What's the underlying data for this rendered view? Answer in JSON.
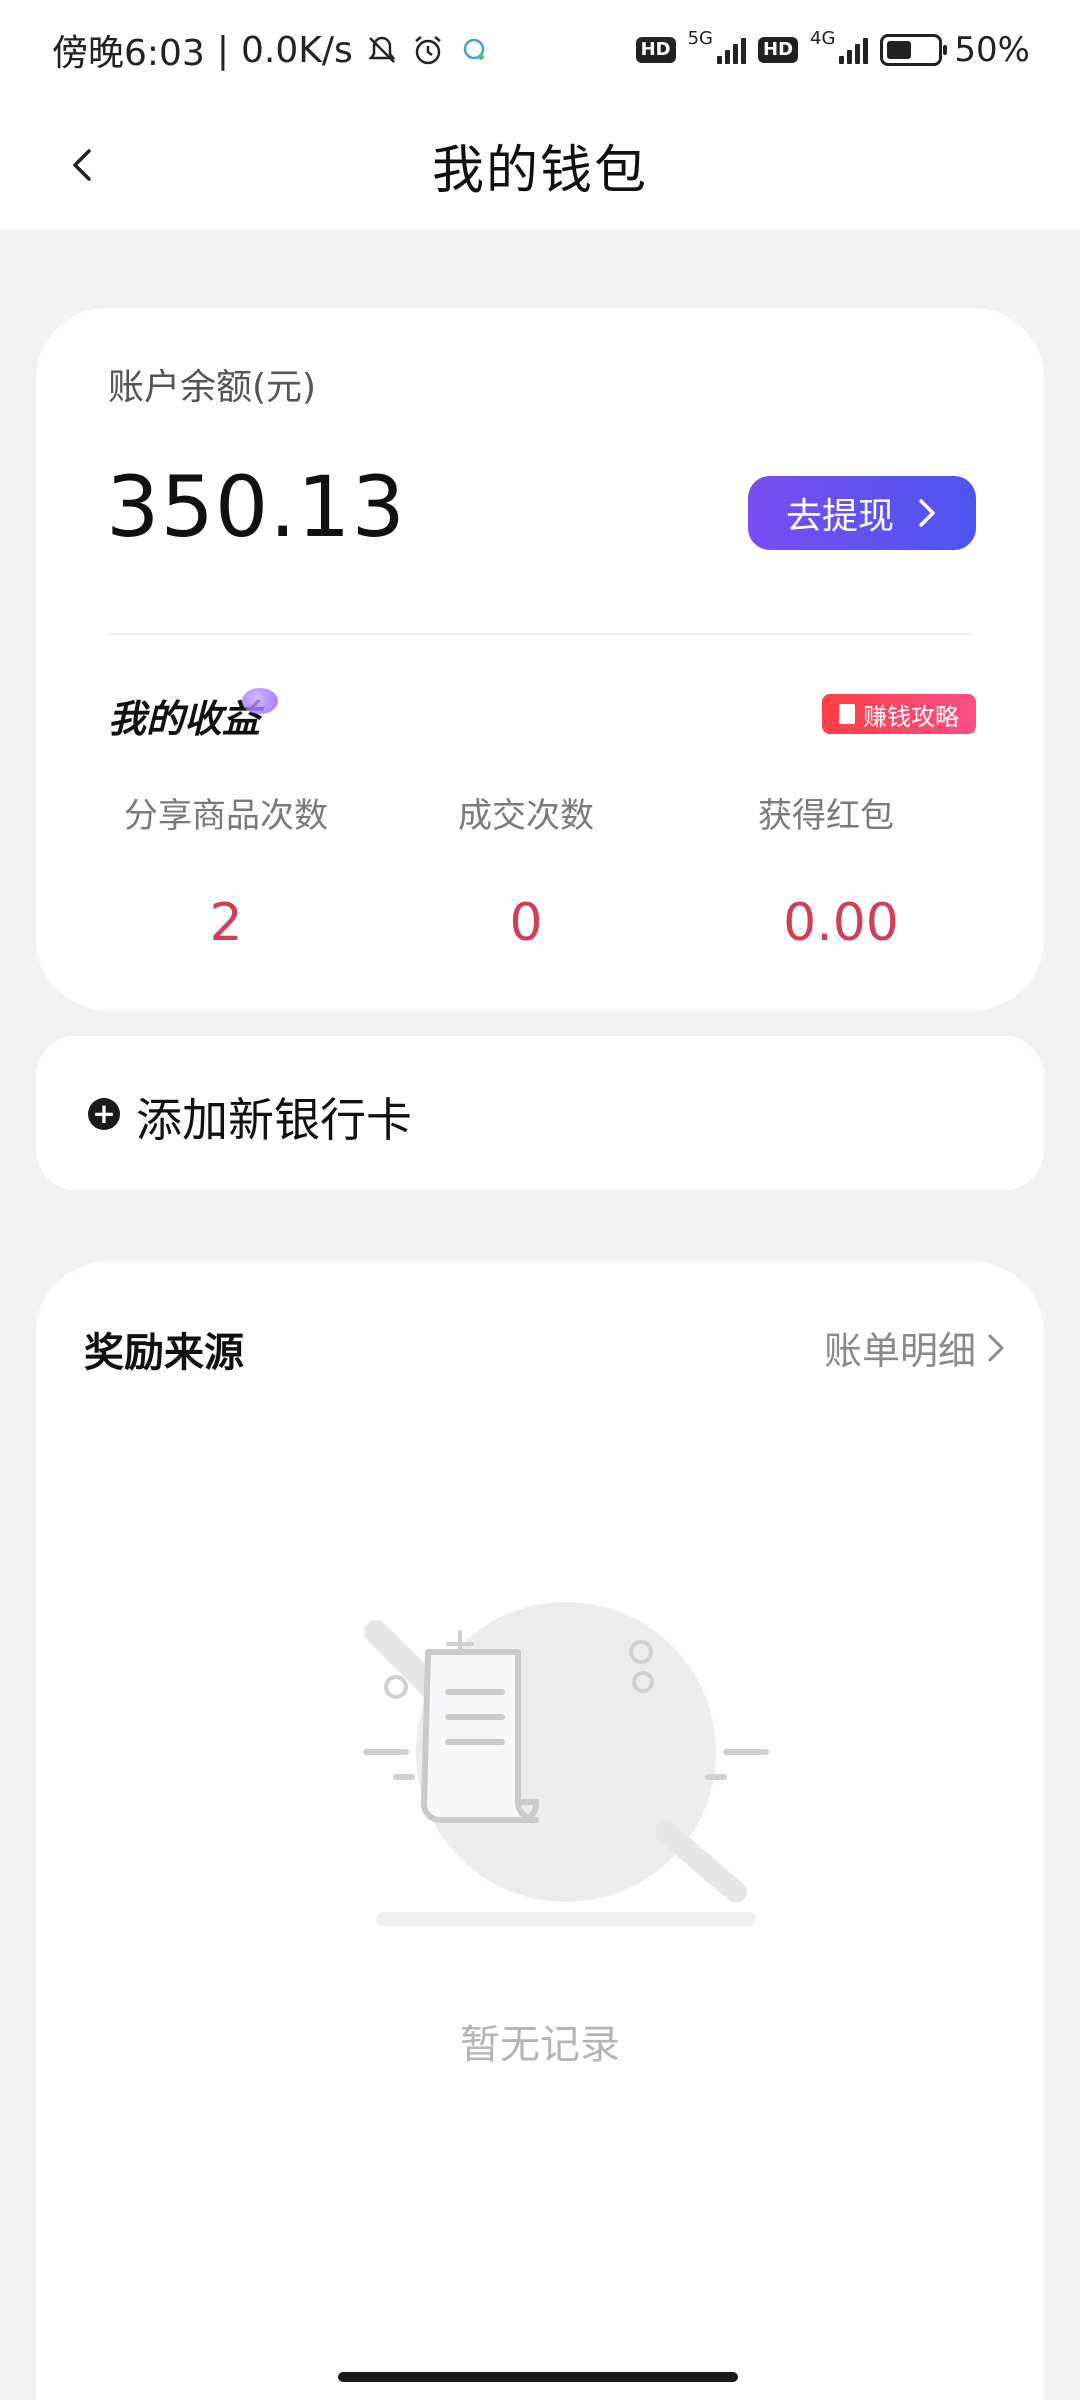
{
  "status_bar": {
    "time": "傍晚6:03",
    "speed": "0.0K/s",
    "network1": "5G",
    "network2": "4G",
    "hd": "HD",
    "battery": "50%",
    "battery_level": 0.5
  },
  "header": {
    "title": "我的钱包",
    "back_icon": "chevron-left-icon"
  },
  "balance": {
    "label": "账户余额(元)",
    "value": "350.13",
    "withdraw_label": "去提现"
  },
  "earnings": {
    "title": "我的收益",
    "strategy_label": "赚钱攻略",
    "stats": [
      {
        "label": "分享商品次数",
        "value": "2"
      },
      {
        "label": "成交次数",
        "value": "0"
      },
      {
        "label": "获得红包",
        "value": "0.00"
      }
    ]
  },
  "bank": {
    "add_label": "添加新银行卡"
  },
  "rewards": {
    "title": "奖励来源",
    "bill_link": "账单明细",
    "empty_text": "暂无记录"
  },
  "colors": {
    "accent_gradient_start": "#7a4ef3",
    "accent_gradient_end": "#4c55f0",
    "stat_value": "#d23e58",
    "badge": "#ff3e46"
  }
}
